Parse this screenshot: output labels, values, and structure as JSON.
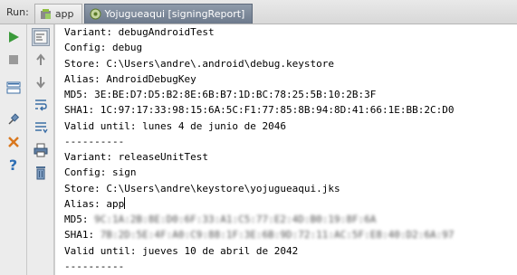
{
  "run_label": "Run:",
  "tabs": [
    {
      "label": "app",
      "icon": "android-icon"
    },
    {
      "label": "Yojugueaqui [signingReport]",
      "icon": "gradle-icon"
    }
  ],
  "toolbar_left": [
    "run-icon",
    "stop-icon",
    "layout-icon",
    "pin-icon",
    "close-icon",
    "help-icon"
  ],
  "toolbar_right": [
    "soft-wrap-icon",
    "scroll-up-icon",
    "scroll-down-icon",
    "wrap-lines-icon",
    "scroll-to-end-icon",
    "print-icon",
    "clear-icon"
  ],
  "console": {
    "lines": [
      "Variant: debugAndroidTest",
      "Config: debug",
      "Store: C:\\Users\\andre\\.android\\debug.keystore",
      "Alias: AndroidDebugKey",
      "MD5: 3E:BE:D7:D5:B2:8E:6B:B7:1D:BC:78:25:5B:10:2B:3F",
      "SHA1: 1C:97:17:33:98:15:6A:5C:F1:77:85:8B:94:8D:41:66:1E:BB:2C:D0",
      "Valid until: lunes 4 de junio de 2046",
      "----------",
      "Variant: releaseUnitTest",
      "Config: sign",
      "Store: C:\\Users\\andre\\keystore\\yojugueaqui.jks",
      "Alias: app",
      "MD5:",
      "SHA1:",
      "Valid until: jueves 10 de abril de 2042",
      "----------"
    ],
    "md5_redacted": "9C:1A:2B:8E:D0:6F:33:A1:C5:77:E2:4D:B0:19:8F:6A",
    "sha1_redacted": "7B:2D:5E:4F:A0:C9:88:1F:3E:6B:9D:72:11:AC:5F:E8:40:D2:6A:97"
  }
}
